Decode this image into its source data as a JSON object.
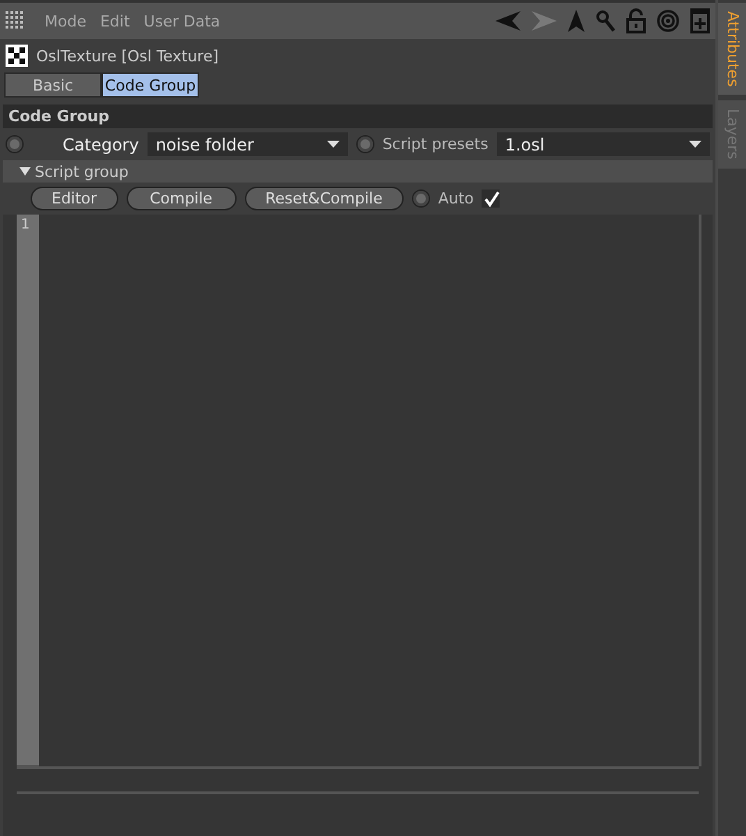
{
  "menu": [
    "Mode",
    "Edit",
    "User Data"
  ],
  "object_title": "OslTexture [Osl Texture]",
  "tabs": [
    {
      "label": "Basic",
      "selected": false
    },
    {
      "label": "Code Group",
      "selected": true
    }
  ],
  "section": "Code Group",
  "fields": [
    {
      "label": "Category",
      "value": "noise folder"
    },
    {
      "label": "Script presets",
      "value": "1.osl"
    }
  ],
  "script_group": {
    "title": "Script group",
    "expanded": true
  },
  "buttons": [
    "Editor",
    "Compile",
    "Reset&Compile"
  ],
  "auto": {
    "label": "Auto",
    "checked": true
  },
  "editor": {
    "line_numbers": [
      "1"
    ]
  },
  "side_tabs": [
    {
      "label": "Attributes",
      "selected": true
    },
    {
      "label": "Layers",
      "selected": false
    }
  ]
}
